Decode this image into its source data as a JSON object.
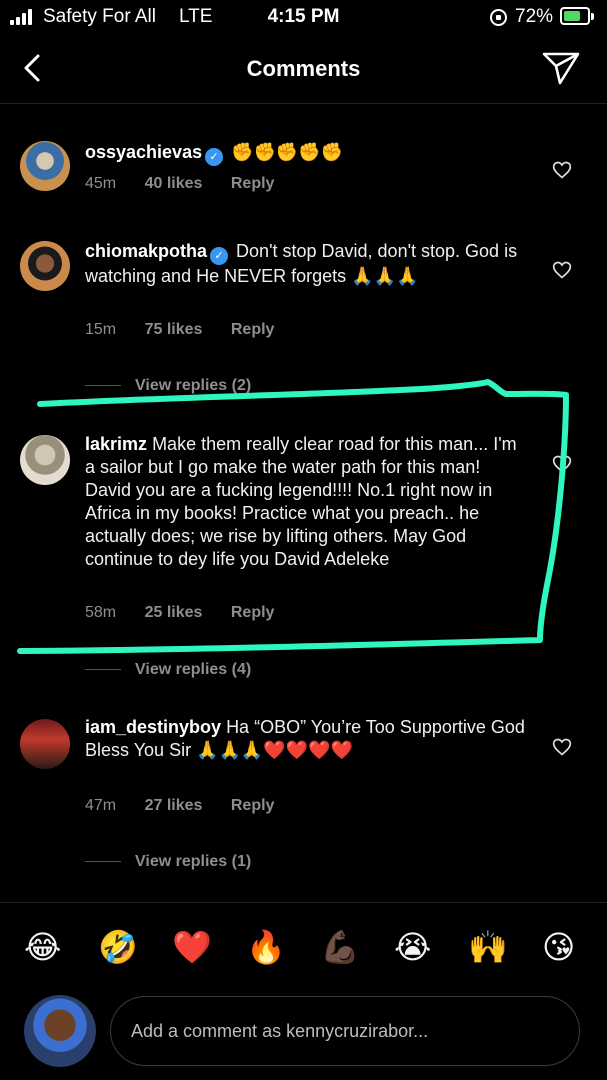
{
  "status_bar": {
    "carrier": "Safety For All",
    "network": "LTE",
    "time": "4:15 PM",
    "battery": "72%",
    "battery_level": 0.72
  },
  "header": {
    "title": "Comments",
    "back_icon": "chevron-left-icon",
    "send_icon": "paper-plane-icon"
  },
  "comments": [
    {
      "username": "ossyachievas",
      "verified": true,
      "text": "✊✊✊✊✊",
      "time": "45m",
      "likes": "40 likes",
      "reply": "Reply"
    },
    {
      "username": "chiomakpotha",
      "verified": true,
      "text": "Don't stop David, don't stop. God is watching and He NEVER forgets 🙏🙏🙏",
      "time": "15m",
      "likes": "75 likes",
      "reply": "Reply",
      "view_replies": "View replies (2)"
    },
    {
      "username": "lakrimz",
      "verified": false,
      "text": "Make them really clear road for this man... I'm a sailor but I go make the water path for this man! David you are a fucking legend!!!! No.1 right now in Africa in my books! Practice what you preach.. he actually does; we rise by lifting others. May God continue to dey life you David Adeleke",
      "time": "58m",
      "likes": "25 likes",
      "reply": "Reply",
      "view_replies": "View replies (4)"
    },
    {
      "username": "iam_destinyboy",
      "verified": false,
      "text": "Ha “OBO” You’re Too Supportive God Bless You Sir 🙏🙏🙏❤️❤️❤️❤️",
      "time": "47m",
      "likes": "27 likes",
      "reply": "Reply",
      "view_replies": "View replies (1)"
    }
  ],
  "emoji_bar": [
    "😂",
    "🤣",
    "❤️",
    "🔥",
    "💪🏿",
    "😭",
    "🙌",
    "😘"
  ],
  "composer": {
    "placeholder": "Add a comment as kennycruzirabor..."
  },
  "colors": {
    "background": "#000000",
    "muted_text": "#8e8e8e",
    "verified_blue": "#3897f0",
    "highlight_stroke": "#2ff5c0"
  }
}
